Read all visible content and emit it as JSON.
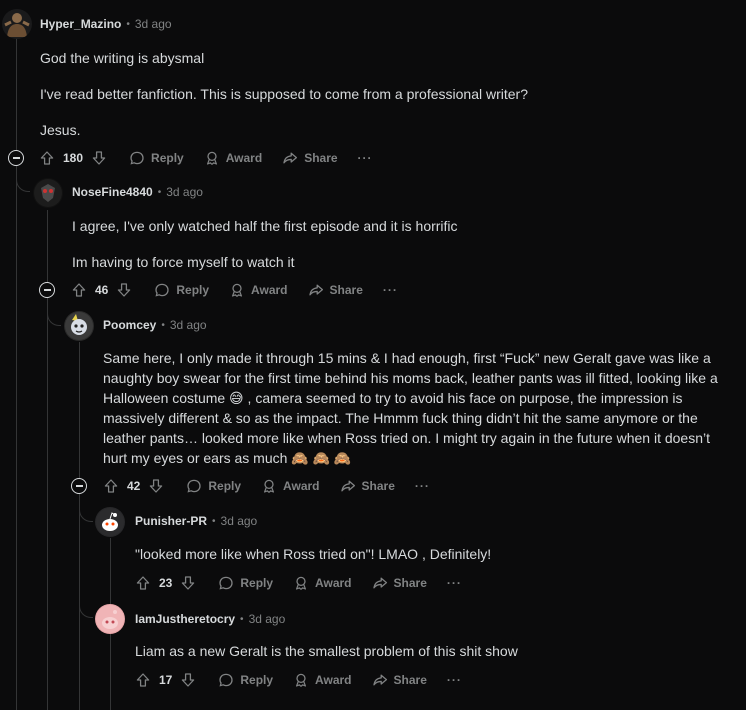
{
  "actions": {
    "reply": "Reply",
    "award": "Award",
    "share": "Share",
    "more": "···"
  },
  "comments": [
    {
      "author": "Hyper_Mazino",
      "time": "3d ago",
      "paragraphs": [
        "God the writing is abysmal",
        "I've read better fanfiction. This is supposed to come from a professional writer?",
        "Jesus."
      ],
      "score": "180"
    },
    {
      "author": "NoseFine4840",
      "time": "3d ago",
      "paragraphs": [
        "I agree, I've only watched half the first episode and it is horrific",
        "Im having to force myself to watch it"
      ],
      "score": "46"
    },
    {
      "author": "Poomcey",
      "time": "3d ago",
      "paragraphs": [
        "Same here, I only made it through 15 mins & I had enough, first “Fuck” new Geralt gave was like a naughty boy swear for the first time behind his moms back, leather pants was ill fitted, looking like a Halloween costume 😅 , camera seemed to try to avoid his face on purpose, the impression is massively different & so as the impact. The Hmmm fuck thing didn’t hit the same anymore or the leather pants… looked more like when Ross tried on. I might try again in the future when it doesn’t hurt my eyes or ears as much 🙈 🙈 🙈"
      ],
      "score": "42"
    },
    {
      "author": "Punisher-PR",
      "time": "3d ago",
      "paragraphs": [
        "\"looked more like when Ross tried on\"! LMAO , Definitely!"
      ],
      "score": "23"
    },
    {
      "author": "IamJustheretocry",
      "time": "3d ago",
      "paragraphs": [
        "Liam as a new Geralt is the smallest problem of this shit show"
      ],
      "score": "17"
    }
  ]
}
